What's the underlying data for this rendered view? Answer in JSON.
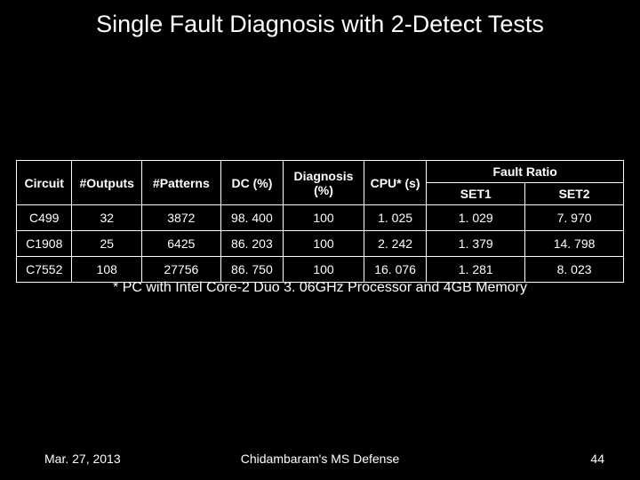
{
  "title": "Single Fault Diagnosis with 2-Detect Tests",
  "headers": {
    "circuit": "Circuit",
    "outputs": "#Outputs",
    "patterns": "#Patterns",
    "dc": "DC (%)",
    "diagnosis": "Diagnosis (%)",
    "cpu": "CPU* (s)",
    "faultratio": "Fault Ratio",
    "set1": "SET1",
    "set2": "SET2"
  },
  "rows": [
    {
      "circuit": "C499",
      "outputs": "32",
      "patterns": "3872",
      "dc": "98. 400",
      "diagnosis": "100",
      "cpu": "1. 025",
      "set1": "1. 029",
      "set2": "7. 970"
    },
    {
      "circuit": "C1908",
      "outputs": "25",
      "patterns": "6425",
      "dc": "86. 203",
      "diagnosis": "100",
      "cpu": "2. 242",
      "set1": "1. 379",
      "set2": "14. 798"
    },
    {
      "circuit": "C7552",
      "outputs": "108",
      "patterns": "27756",
      "dc": "86. 750",
      "diagnosis": "100",
      "cpu": "16. 076",
      "set1": "1. 281",
      "set2": "8. 023"
    }
  ],
  "footnote": "* PC with Intel Core-2 Duo 3. 06GHz Processor and 4GB Memory",
  "footer": {
    "date": "Mar. 27, 2013",
    "center": "Chidambaram's MS Defense",
    "page": "44"
  },
  "chart_data": {
    "type": "table",
    "title": "Single Fault Diagnosis with 2-Detect Tests",
    "columns": [
      "Circuit",
      "#Outputs",
      "#Patterns",
      "DC (%)",
      "Diagnosis (%)",
      "CPU* (s)",
      "Fault Ratio SET1",
      "Fault Ratio SET2"
    ],
    "data": [
      [
        "C499",
        32,
        3872,
        98.4,
        100,
        1.025,
        1.029,
        7.97
      ],
      [
        "C1908",
        25,
        6425,
        86.203,
        100,
        2.242,
        1.379,
        14.798
      ],
      [
        "C7552",
        108,
        27756,
        86.75,
        100,
        16.076,
        1.281,
        8.023
      ]
    ]
  }
}
